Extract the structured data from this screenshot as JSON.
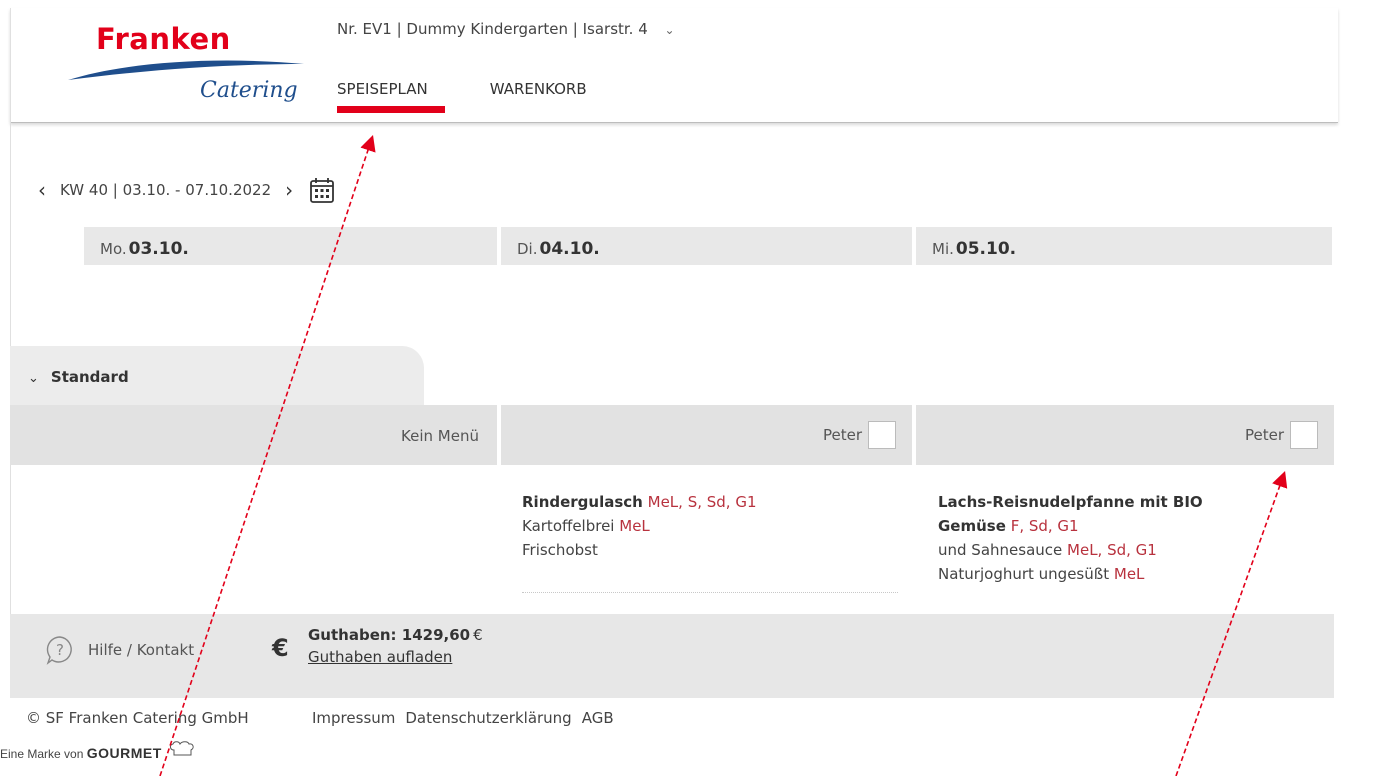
{
  "header": {
    "brand": "Franken",
    "brand_script": "Catering",
    "location": "Nr. EV1 | Dummy Kindergarten | Isarstr. 4",
    "tabs": [
      {
        "label": "SPEISEPLAN",
        "active": true
      },
      {
        "label": "WARENKORB",
        "active": false
      }
    ]
  },
  "week": {
    "label": "KW 40 | 03.10. - 07.10.2022",
    "days": [
      {
        "prefix": "Mo.",
        "date": "03.10."
      },
      {
        "prefix": "Di.",
        "date": "04.10."
      },
      {
        "prefix": "Mi.",
        "date": "05.10."
      }
    ]
  },
  "menu": {
    "section": "Standard",
    "no_menu": "Kein Menü",
    "person_tue": "Peter",
    "person_wed": "Peter",
    "tue": {
      "title": "Rindergulasch",
      "title_allergens": "MeL, S, Sd, G1",
      "line2": "Kartoffelbrei",
      "line2_allergens": "MeL",
      "line3": "Frischobst"
    },
    "wed": {
      "title_a": "Lachs-Reisnudelpfanne mit BIO",
      "title_b": "Gemüse",
      "title_allergens": "F, Sd, G1",
      "line3": "und Sahnesauce",
      "line3_allergens": "MeL, Sd, G1",
      "line4": "Naturjoghurt ungesüßt",
      "line4_allergens": "MeL"
    }
  },
  "footer": {
    "help": "Hilfe / Kontakt",
    "currency": "€",
    "balance_label": "Guthaben: 1429,60",
    "balance_unit": "€",
    "topup": "Guthaben aufladen",
    "copyright": "© SF Franken Catering GmbH",
    "links": [
      "Impressum",
      "Datenschutzerklärung",
      "AGB"
    ],
    "brand_prefix": "Eine Marke von",
    "brand_name": "GOURMET"
  },
  "colors": {
    "accent": "#e2001a",
    "allergen": "#b8323e",
    "brand_blue": "#1f4e8c"
  }
}
